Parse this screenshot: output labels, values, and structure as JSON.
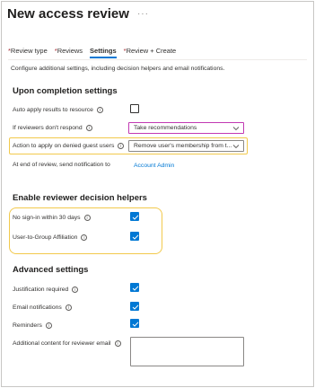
{
  "header": {
    "title": "New access review",
    "more": "···"
  },
  "tabs": [
    {
      "label": "Review type",
      "required": "*",
      "active": false
    },
    {
      "label": "Reviews",
      "required": "*",
      "active": false
    },
    {
      "label": "Settings",
      "required": "",
      "active": true
    },
    {
      "label": "Review + Create",
      "required": "*",
      "active": false
    }
  ],
  "description": "Configure additional settings, including decision helpers and email notifications.",
  "completion": {
    "title": "Upon completion settings",
    "auto_apply_label": "Auto apply results to resource",
    "auto_apply_checked": false,
    "no_response_label": "If reviewers don't respond",
    "no_response_value": "Take recommendations",
    "denied_guest_label": "Action to apply on denied guest users",
    "denied_guest_value": "Remove user's membership from t...",
    "notify_label": "At end of review, send notification to",
    "notify_value": "Account Admin"
  },
  "helpers": {
    "title": "Enable reviewer decision helpers",
    "no_signin_label": "No sign-in within 30 days",
    "no_signin_checked": true,
    "affiliation_label": "User-to-Group Affiliation",
    "affiliation_checked": true
  },
  "advanced": {
    "title": "Advanced settings",
    "justification_label": "Justification required",
    "justification_checked": true,
    "email_label": "Email notifications",
    "email_checked": true,
    "reminders_label": "Reminders",
    "reminders_checked": true,
    "additional_label": "Additional content for reviewer email",
    "additional_value": ""
  },
  "colors": {
    "accent": "#0078d4",
    "highlight": "#f2c94c",
    "required": "#a4262c",
    "dropdown_focus": "#c239b3"
  },
  "icons": {
    "info": "info-icon",
    "chevron": "chevron-down-icon",
    "check": "checkmark-icon",
    "more": "more-icon"
  }
}
